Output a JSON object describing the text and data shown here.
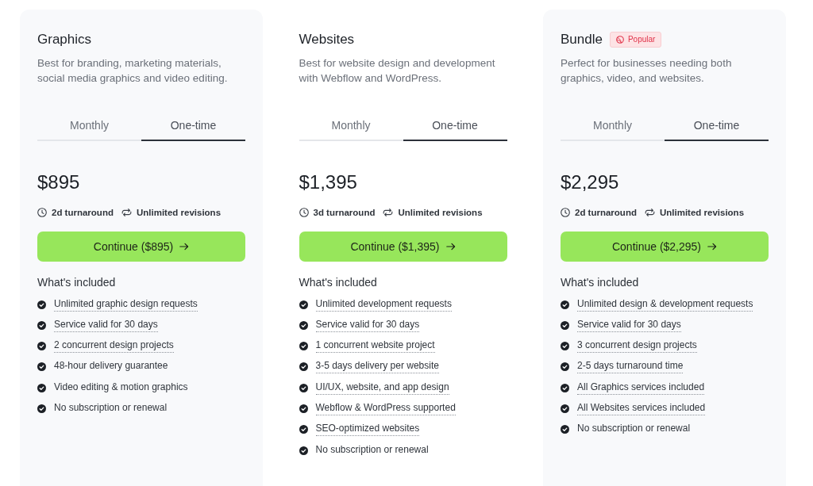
{
  "plans": [
    {
      "name": "Graphics",
      "color": "#f8f9fb",
      "description": "Best for branding, marketing materials, social media graphics and video editing.",
      "tabs": [
        {
          "label": "Monthly",
          "selected": false
        },
        {
          "label": "One-time",
          "selected": true
        }
      ],
      "price": "$895",
      "perks": [
        {
          "kind": "turnaround",
          "label": "2d turnaround"
        },
        {
          "kind": "revisions",
          "label": "Unlimited revisions"
        }
      ],
      "button": "Continue ($895)",
      "features_heading": "What's included",
      "features": [
        {
          "label": "Unlimited graphic design requests",
          "underlined": true
        },
        {
          "label": "Service valid for 30 days",
          "underlined": true
        },
        {
          "label": "2 concurrent design projects",
          "underlined": true
        },
        {
          "label": "48-hour delivery guarantee",
          "underlined": false
        },
        {
          "label": "Video editing & motion graphics",
          "underlined": false
        },
        {
          "label": "No subscription or renewal",
          "underlined": false
        }
      ]
    },
    {
      "name": "Websites",
      "color": "#ffffff",
      "description": "Best for website design and development with Webflow and WordPress.",
      "tabs": [
        {
          "label": "Monthly",
          "selected": false
        },
        {
          "label": "One-time",
          "selected": true
        }
      ],
      "price": "$1,395",
      "perks": [
        {
          "kind": "turnaround",
          "label": "3d turnaround"
        },
        {
          "kind": "revisions",
          "label": "Unlimited revisions"
        }
      ],
      "button": "Continue ($1,395)",
      "features_heading": "What's included",
      "features": [
        {
          "label": "Unlimited development requests",
          "underlined": true
        },
        {
          "label": "Service valid for 30 days",
          "underlined": true
        },
        {
          "label": "1 concurrent website project",
          "underlined": true
        },
        {
          "label": "3-5 days delivery per website",
          "underlined": true
        },
        {
          "label": "UI/UX, website, and app design",
          "underlined": true
        },
        {
          "label": "Webflow & WordPress supported",
          "underlined": true
        },
        {
          "label": "SEO-optimized websites",
          "underlined": true
        },
        {
          "label": "No subscription or renewal",
          "underlined": false
        }
      ]
    },
    {
      "name": "Bundle",
      "badge": "Popular",
      "color": "#f8f9fb",
      "description": "Perfect for businesses needing both graphics, video, and websites.",
      "tabs": [
        {
          "label": "Monthly",
          "selected": false
        },
        {
          "label": "One-time",
          "selected": true
        }
      ],
      "price": "$2,295",
      "perks": [
        {
          "kind": "turnaround",
          "label": "2d turnaround"
        },
        {
          "kind": "revisions",
          "label": "Unlimited revisions"
        }
      ],
      "button": "Continue ($2,295)",
      "features_heading": "What's included",
      "features": [
        {
          "label": "Unlimited design & development requests",
          "underlined": true
        },
        {
          "label": "Service valid for 30 days",
          "underlined": true
        },
        {
          "label": "3 concurrent design projects",
          "underlined": true
        },
        {
          "label": "2-5 days turnaround time",
          "underlined": true
        },
        {
          "label": "All Graphics services included",
          "underlined": true
        },
        {
          "label": "All Websites services included",
          "underlined": true
        },
        {
          "label": "No subscription or renewal",
          "underlined": false
        }
      ]
    }
  ]
}
